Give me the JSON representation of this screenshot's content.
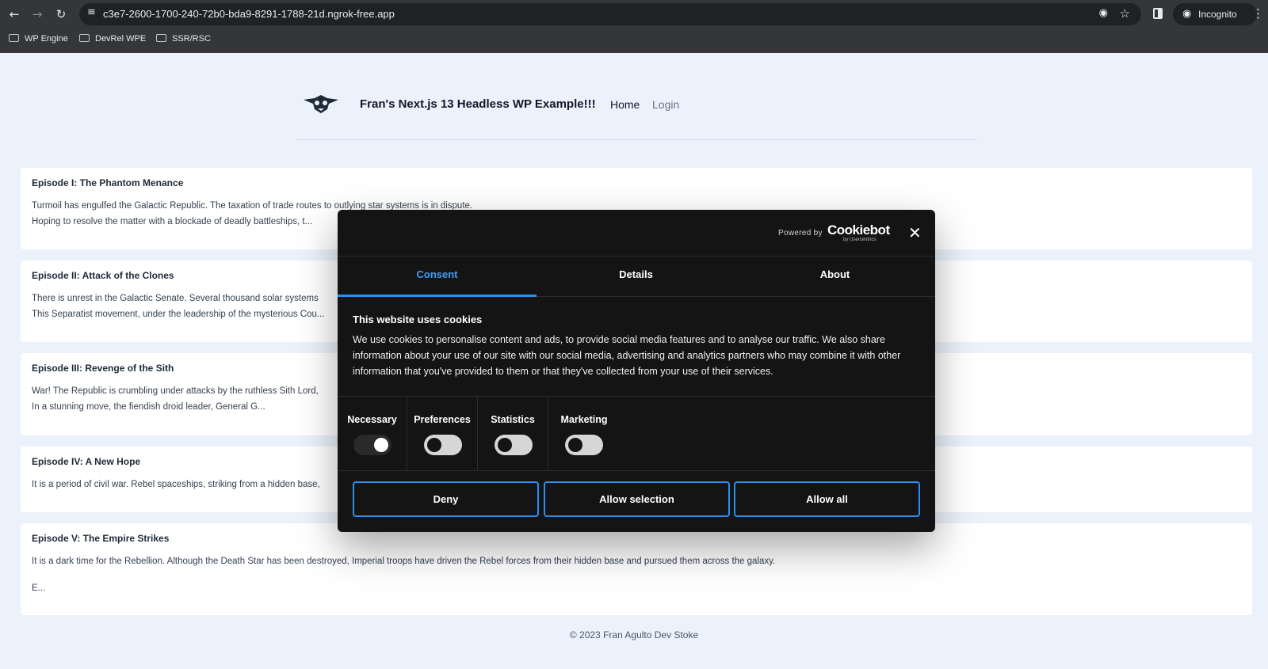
{
  "browser": {
    "url": "c3e7-2600-1700-240-72b0-bda9-8291-1788-21d.ngrok-free.app",
    "profile_label": "Incognito",
    "bookmarks": [
      "WP Engine",
      "DevRel WPE",
      "SSR/RSC"
    ]
  },
  "site": {
    "title": "Fran's Next.js 13 Headless WP Example!!!",
    "nav": [
      "Home",
      "Login"
    ]
  },
  "posts": [
    {
      "title": "Episode I: The Phantom Menance",
      "lines": [
        "Turmoil has engulfed the Galactic Republic. The taxation of trade routes to outlying star systems is in dispute.",
        "Hoping to resolve the matter with a blockade of deadly battleships, t..."
      ]
    },
    {
      "title": "Episode II: Attack of the Clones",
      "lines": [
        "There is unrest in the Galactic Senate. Several thousand solar systems",
        "This Separatist movement, under the leadership of the mysterious Cou..."
      ]
    },
    {
      "title": "Episode III: Revenge of the Sith",
      "lines": [
        "War! The Republic is crumbling under attacks by the ruthless Sith Lord,",
        "In a stunning move, the fiendish droid leader, General G..."
      ]
    },
    {
      "title": "Episode IV: A New Hope",
      "lines": [
        "It is a period of civil war. Rebel spaceships, striking from a hidden base,"
      ]
    },
    {
      "title": "Episode V: The Empire Strikes",
      "lines": [
        "It is a dark time for the Rebellion. Although the Death Star has been destroyed, Imperial troops have driven the Rebel forces from their hidden base and pursued them across the galaxy.",
        "E..."
      ]
    }
  ],
  "footer": "© 2023 Fran Agulto Dev Stoke",
  "cookie_dialog": {
    "powered_by": "Powered by",
    "brand": "Cookiebot",
    "brand_sub": "by Usercentrics",
    "tabs": [
      "Consent",
      "Details",
      "About"
    ],
    "active_tab": "Consent",
    "heading": "This website uses cookies",
    "body": "We use cookies to personalise content and ads, to provide social media features and to analyse our traffic. We also share information about your use of our site with our social media, advertising and analytics partners who may combine it with other information that you've provided to them or that they've collected from your use of their services.",
    "toggles": [
      {
        "label": "Necessary",
        "on": true
      },
      {
        "label": "Preferences",
        "on": false
      },
      {
        "label": "Statistics",
        "on": false
      },
      {
        "label": "Marketing",
        "on": false
      }
    ],
    "buttons": [
      "Deny",
      "Allow selection",
      "Allow all"
    ],
    "accent_color": "#2b8ff0"
  },
  "icons": [
    "back-icon",
    "forward-icon",
    "reload-icon",
    "site-settings-icon",
    "eye-off-icon",
    "star-icon",
    "side-panel-icon",
    "incognito-icon",
    "more-menu-icon",
    "folder-icon",
    "close-icon"
  ]
}
